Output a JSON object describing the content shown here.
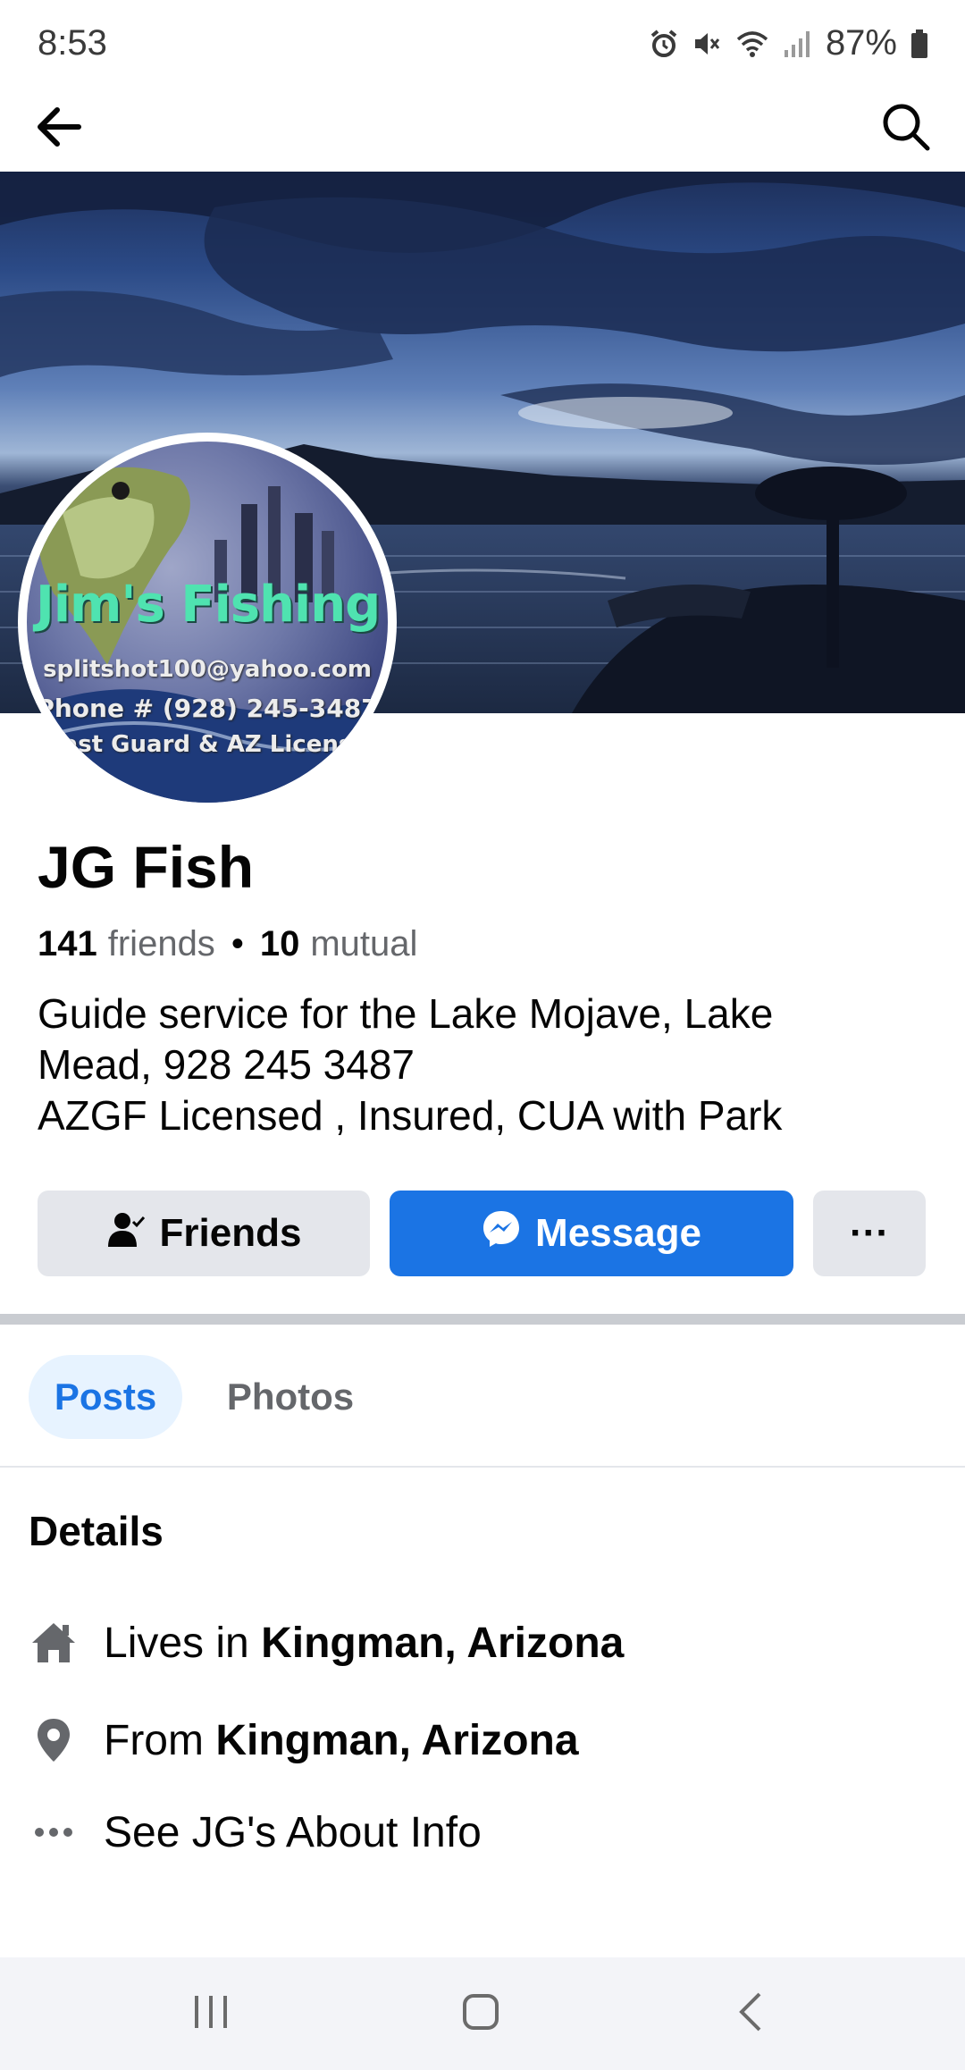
{
  "status_bar": {
    "time": "8:53",
    "battery_percent": "87%",
    "icons": [
      "alarm-icon",
      "mute-icon",
      "wifi-icon",
      "signal-icon",
      "battery-icon"
    ]
  },
  "header": {
    "back_icon": "back-arrow-icon",
    "search_icon": "search-icon"
  },
  "avatar": {
    "title": "Jim's Fishing",
    "lines": [
      "splitshot100@yahoo.com",
      "Phone # (928) 245-3487",
      "ast Guard & AZ Licens"
    ]
  },
  "profile": {
    "name": "JG Fish",
    "friends_count": "141",
    "friends_label": "friends",
    "separator": "•",
    "mutual_count": "10",
    "mutual_label": "mutual",
    "bio_lines": [
      "Guide service for the Lake Mojave, Lake",
      "Mead, 928 245 3487",
      "AZGF Licensed , Insured, CUA with Park"
    ]
  },
  "actions": {
    "friends_label": "Friends",
    "message_label": "Message",
    "more_label": "···"
  },
  "tabs": [
    {
      "label": "Posts",
      "active": true
    },
    {
      "label": "Photos",
      "active": false
    }
  ],
  "details": {
    "title": "Details",
    "lives_prefix": "Lives in ",
    "lives_place": "Kingman, Arizona",
    "from_prefix": "From ",
    "from_place": "Kingman, Arizona",
    "about_label": "See JG's About Info"
  },
  "colors": {
    "accent": "#1b74e4",
    "tab_active_bg": "#e7f3ff",
    "button_gray": "#e4e6eb",
    "secondary_text": "#65676b"
  }
}
